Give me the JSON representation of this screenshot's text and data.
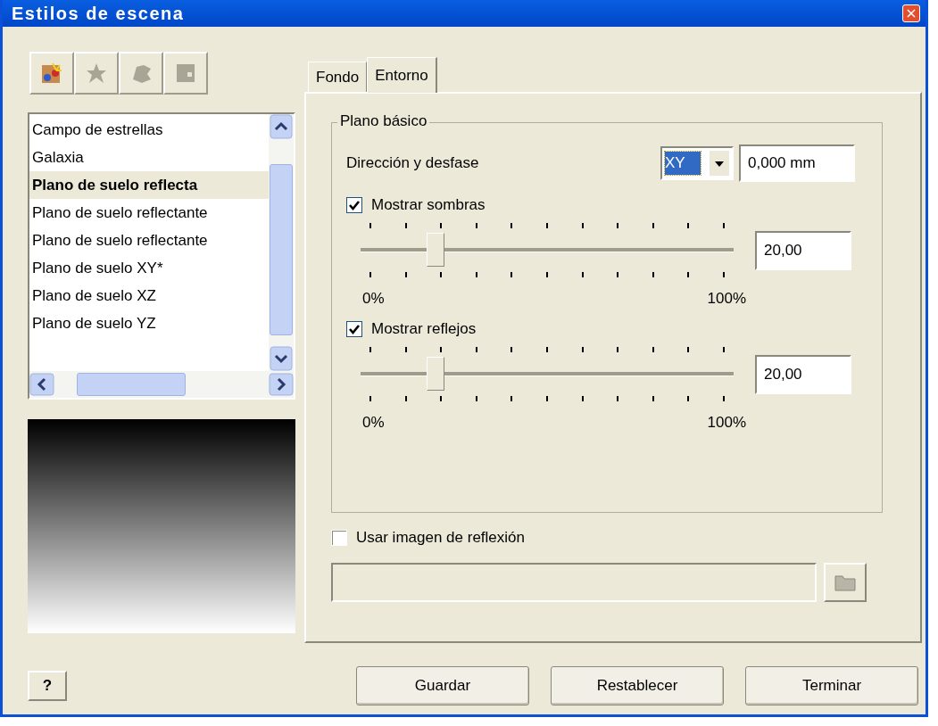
{
  "window": {
    "title": "Estilos de escena",
    "close": "×"
  },
  "toolbar": [
    {
      "kind": "new",
      "disabled": false
    },
    {
      "kind": "star",
      "disabled": true
    },
    {
      "kind": "blob",
      "disabled": true
    },
    {
      "kind": "save",
      "disabled": true
    }
  ],
  "styles": [
    {
      "label": "Campo de estrellas",
      "selected": false
    },
    {
      "label": "Galaxia",
      "selected": false
    },
    {
      "label": "Plano de suelo reflecta",
      "selected": true
    },
    {
      "label": "Plano de suelo reflectante",
      "selected": false
    },
    {
      "label": "Plano de suelo reflectante",
      "selected": false
    },
    {
      "label": "Plano de suelo XY*",
      "selected": false
    },
    {
      "label": "Plano de suelo XZ",
      "selected": false
    },
    {
      "label": "Plano de suelo YZ",
      "selected": false
    }
  ],
  "tabs": [
    {
      "label": "Fondo",
      "selected": false
    },
    {
      "label": "Entorno",
      "selected": true
    }
  ],
  "group": {
    "legend": "Plano básico",
    "direction_label": "Dirección y desfase",
    "plane": "XY",
    "offset": "0,000 mm"
  },
  "sliders": [
    {
      "label": "Mostrar sombras",
      "checked": true,
      "level": 0.2,
      "value": "20,00",
      "min": "0%",
      "max": "100%"
    },
    {
      "label": "Mostrar reflejos",
      "checked": true,
      "level": 0.2,
      "value": "20,00",
      "min": "0%",
      "max": "100%"
    }
  ],
  "reflection": {
    "label": "Usar imagen de reflexión",
    "checked": false
  },
  "buttons": [
    "Guardar",
    "Restablecer",
    "Terminar"
  ],
  "help": "?"
}
